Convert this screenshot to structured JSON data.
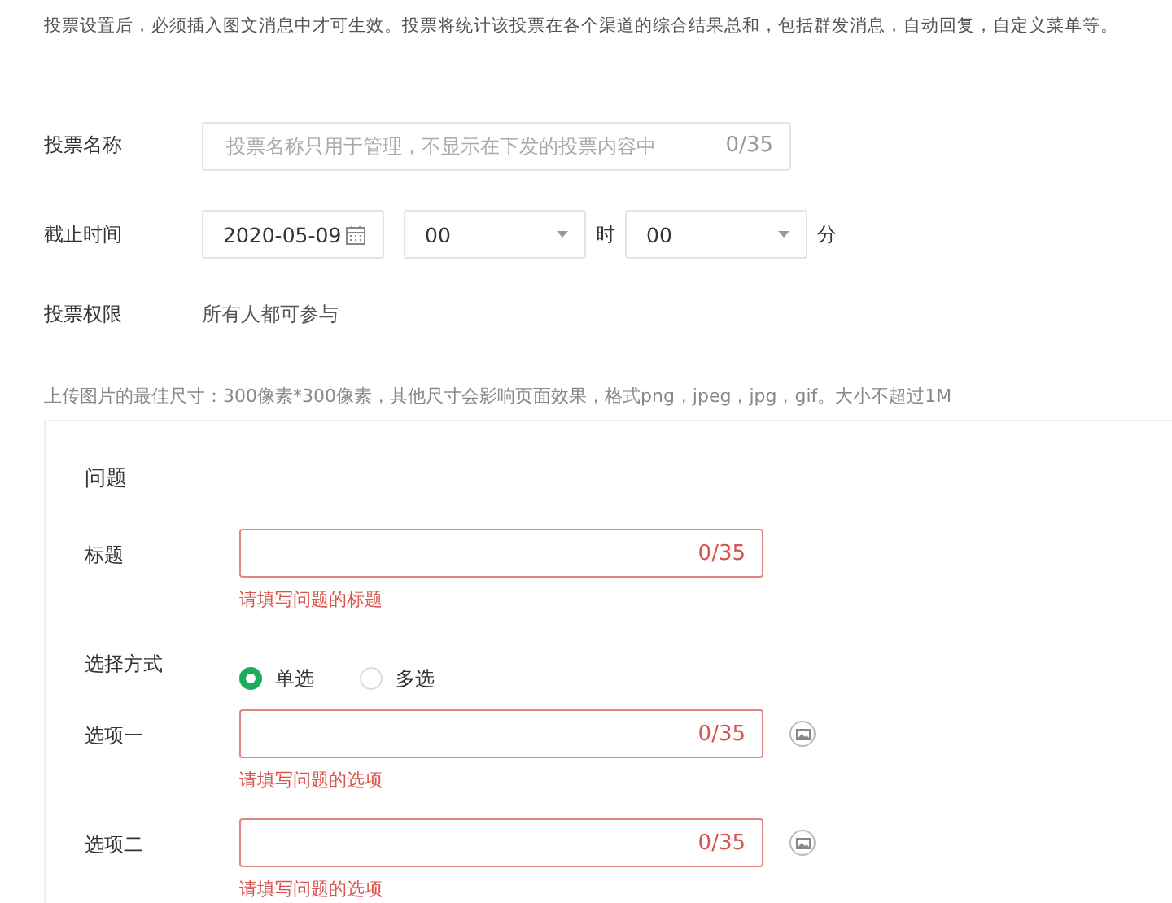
{
  "intro": "投票设置后，必须插入图文消息中才可生效。投票将统计该投票在各个渠道的综合结果总和，包括群发消息，自动回复，自定义菜单等。",
  "settings": [
    {
      "kind": "text",
      "label": "投票名称",
      "placeholder": "投票名称只用于管理，不显示在下发的投票内容中",
      "counter": "0/35"
    },
    {
      "kind": "deadline",
      "label": "截止时间",
      "date": "2020-05-09",
      "hour": "00",
      "hour_unit": "时",
      "minute": "00",
      "minute_unit": "分"
    },
    {
      "kind": "static",
      "label": "投票权限",
      "value": "所有人都可参与"
    }
  ],
  "upload_hint": "上传图片的最佳尺寸：300像素*300像素，其他尺寸会影响页面效果，格式png，jpeg，jpg，gif。大小不超过1M",
  "question": {
    "title": "问题",
    "rows": [
      {
        "kind": "text",
        "label": "标题",
        "counter": "0/35",
        "invalid": true,
        "error": "请填写问题的标题",
        "image_button": false
      },
      {
        "kind": "radio",
        "label": "选择方式",
        "options": [
          {
            "label": "单选",
            "selected": true
          },
          {
            "label": "多选",
            "selected": false
          }
        ]
      },
      {
        "kind": "text",
        "label": "选项一",
        "counter": "0/35",
        "invalid": true,
        "error": "请填写问题的选项",
        "image_button": true
      },
      {
        "kind": "text",
        "label": "选项二",
        "counter": "0/35",
        "invalid": true,
        "error": "请填写问题的选项",
        "image_button": true
      }
    ]
  }
}
